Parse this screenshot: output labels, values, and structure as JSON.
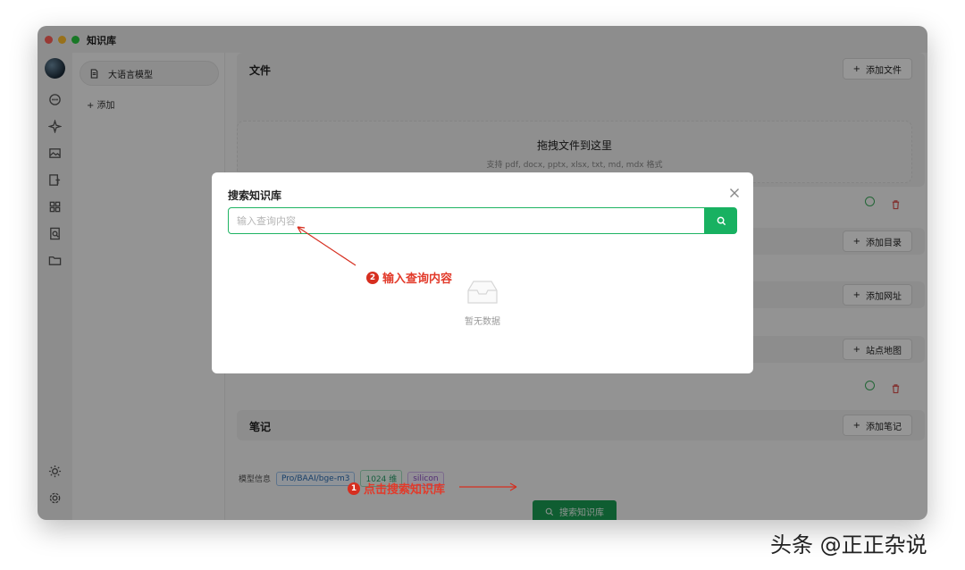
{
  "window": {
    "title": "知识库"
  },
  "sidebar": {
    "kb_name": "大语言模型",
    "add_label": "+ 添加"
  },
  "sections": {
    "files": {
      "title": "文件",
      "add": "添加文件",
      "drop_title": "拖拽文件到这里",
      "drop_sub": "支持 pdf, docx, pptx, xlsx, txt, md, mdx 格式"
    },
    "dirs": {
      "add": "添加目录"
    },
    "urls": {
      "add": "添加网址"
    },
    "sitemap": {
      "add": "站点地图"
    },
    "notes": {
      "title": "笔记",
      "add": "添加笔记"
    }
  },
  "model_info": {
    "label": "模型信息",
    "model": "Pro/BAAI/bge-m3",
    "dims": "1024 维",
    "provider": "silicon"
  },
  "search_button": "搜索知识库",
  "modal": {
    "title": "搜索知识库",
    "placeholder": "输入查询内容",
    "empty": "暂无数据"
  },
  "annotations": {
    "step1": "点击搜索知识库",
    "step1_num": "1",
    "step2": "输入查询内容",
    "step2_num": "2"
  },
  "watermark": "头条 @正正杂说",
  "colors": {
    "accent": "#18b161",
    "annotation": "#e23a2a"
  }
}
